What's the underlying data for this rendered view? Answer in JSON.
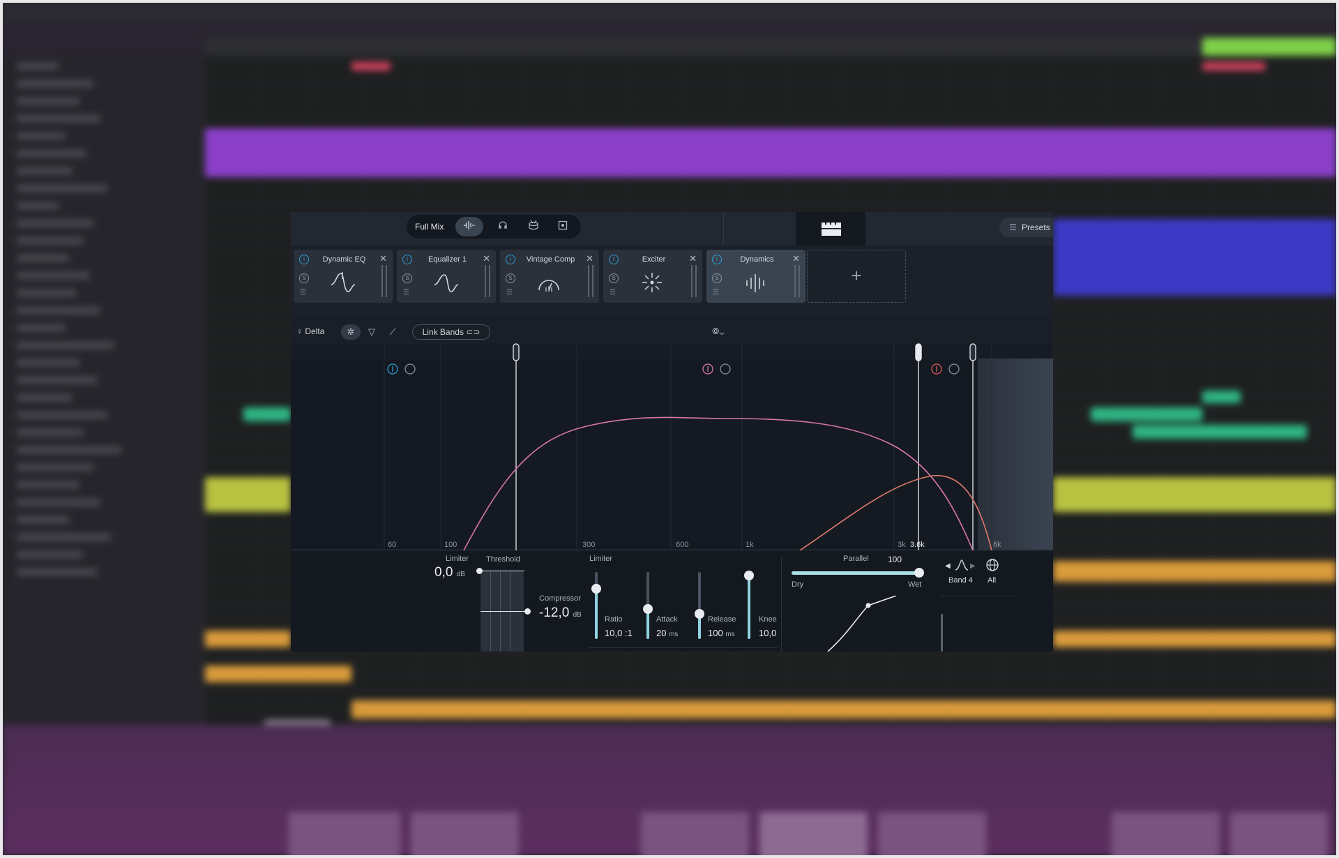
{
  "plugin": {
    "mode_label": "Full Mix",
    "presets_label": "Presets",
    "modules": [
      {
        "name": "Dynamic EQ",
        "active": false
      },
      {
        "name": "Equalizer 1",
        "active": false
      },
      {
        "name": "Vintage Comp",
        "active": false
      },
      {
        "name": "Exciter",
        "active": false
      },
      {
        "name": "Dynamics",
        "active": true
      }
    ],
    "add_module_symbol": "+",
    "module_power_symbol": "I",
    "module_solo_symbol": "S",
    "toolbar": {
      "delta_label": "Delta",
      "link_bands_label": "Link Bands"
    },
    "freq_labels": [
      "60",
      "100",
      "300",
      "600",
      "1k",
      "3k",
      "3.6k",
      "6k"
    ],
    "dynamics": {
      "limiter_top_label": "Limiter",
      "limiter_value": "0,0",
      "limiter_unit": "dB",
      "threshold_label": "Threshold",
      "compressor_label": "Compressor",
      "compressor_value": "-12,0",
      "compressor_unit": "dB",
      "limiter_label": "Limiter",
      "ratio_label": "Ratio",
      "ratio_value": "10,0 :1",
      "attack_label": "Attack",
      "attack_value": "20",
      "attack_unit": "ms",
      "release_label": "Release",
      "release_value": "100",
      "release_unit": "ms",
      "knee_label": "Knee",
      "knee_value": "10,0",
      "parallel_label": "Parallel",
      "parallel_value": "100",
      "dry_label": "Dry",
      "wet_label": "Wet",
      "band_label": "Band 4",
      "all_label": "All"
    },
    "levels": {
      "limiter_slider": 0.75,
      "ratio_slider": 0.45,
      "release_slider": 0.38,
      "knee_slider": 0.95,
      "parallel": 1.0
    }
  },
  "colors": {
    "accent_blue": "#2f9bd2",
    "band_pink": "#d777a6",
    "band_salmon": "#e07a6b",
    "slider_teal": "#8ed3df"
  }
}
